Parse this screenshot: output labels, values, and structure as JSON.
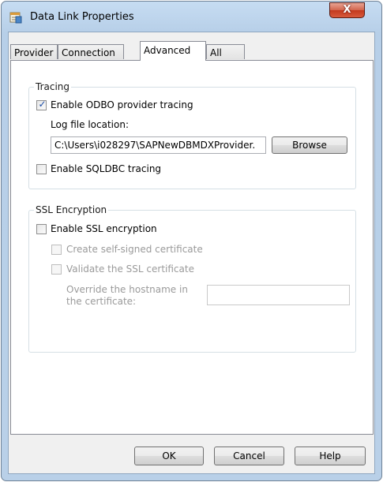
{
  "window": {
    "title": "Data Link Properties",
    "close_glyph": "X"
  },
  "tabs": [
    {
      "label": "Provider",
      "active": false
    },
    {
      "label": "Connection",
      "active": false
    },
    {
      "label": "Advanced",
      "active": true
    },
    {
      "label": "All",
      "active": false
    }
  ],
  "tracing": {
    "group_label": "Tracing",
    "odbo_label": "Enable ODBO provider tracing",
    "odbo_checked": true,
    "log_location_label": "Log file location:",
    "log_location_value": "C:\\Users\\i028297\\SAPNewDBMDXProvider.",
    "browse_label": "Browse",
    "sqldbc_label": "Enable SQLDBC tracing",
    "sqldbc_checked": false
  },
  "ssl": {
    "group_label": "SSL Encryption",
    "enable_label": "Enable SSL encryption",
    "enable_checked": false,
    "self_signed_label": "Create self-signed certificate",
    "validate_label": "Validate the SSL certificate",
    "hostname_label_line1": "Override the hostname in",
    "hostname_label_line2": "the certificate:",
    "hostname_value": ""
  },
  "buttons": {
    "ok": "OK",
    "cancel": "Cancel",
    "help": "Help"
  },
  "colors": {
    "check_mark": "#1f4fa8",
    "close_button": "#c3391d"
  },
  "icons": {
    "app": "data-link-icon",
    "close": "close-icon",
    "check": "checkmark-icon"
  }
}
